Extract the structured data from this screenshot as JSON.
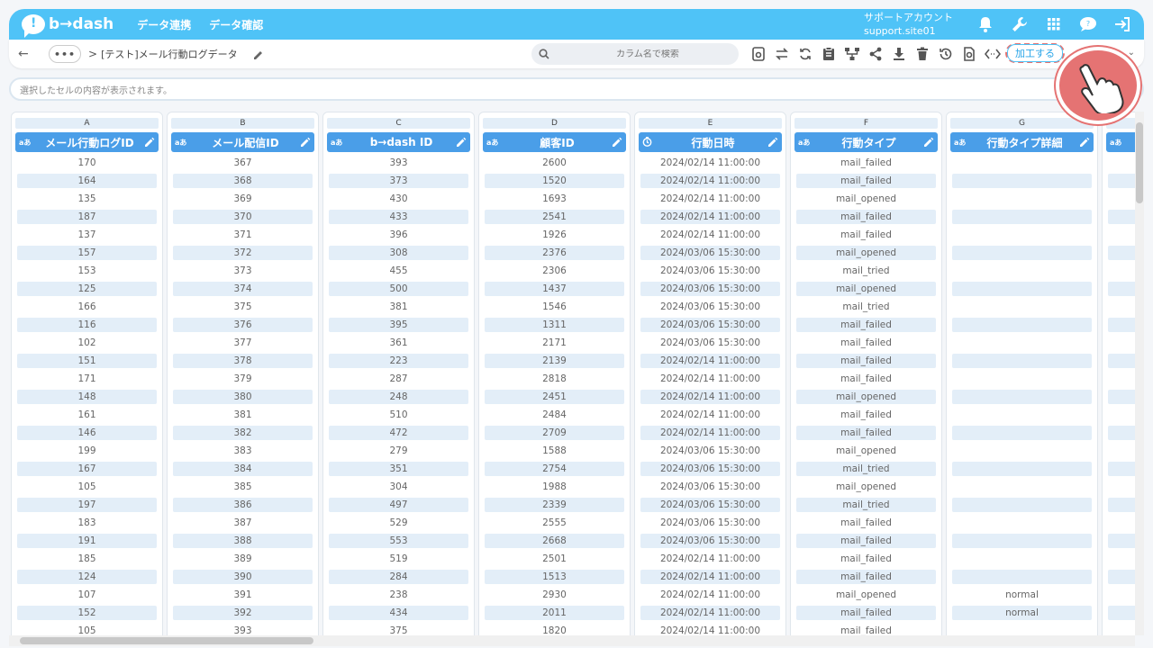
{
  "header": {
    "logo_text": "b→dash",
    "nav": [
      "データ連携",
      "データ確認"
    ],
    "account_name": "サポートアカウント",
    "account_site": "support.site01"
  },
  "toolbar": {
    "more": "•••",
    "separator": ">",
    "sheet_title": "[テスト]メール行動ログデータ",
    "search_placeholder": "カラム名で検索",
    "process_label": "加工する"
  },
  "cellbar": {
    "placeholder": "選択したセルの内容が表示されます。"
  },
  "columns": [
    {
      "letter": "A",
      "type": "aあ",
      "name": "メール行動ログID",
      "values": [
        "170",
        "164",
        "135",
        "187",
        "137",
        "157",
        "153",
        "125",
        "166",
        "116",
        "102",
        "151",
        "171",
        "148",
        "161",
        "146",
        "199",
        "167",
        "105",
        "197",
        "183",
        "191",
        "185",
        "124",
        "107",
        "152",
        "105"
      ]
    },
    {
      "letter": "B",
      "type": "aあ",
      "name": "メール配信ID",
      "values": [
        "367",
        "368",
        "369",
        "370",
        "371",
        "372",
        "373",
        "374",
        "375",
        "376",
        "377",
        "378",
        "379",
        "380",
        "381",
        "382",
        "383",
        "384",
        "385",
        "386",
        "387",
        "388",
        "389",
        "390",
        "391",
        "392",
        "393"
      ]
    },
    {
      "letter": "C",
      "type": "aあ",
      "name": "b→dash ID",
      "values": [
        "393",
        "373",
        "430",
        "433",
        "396",
        "308",
        "455",
        "500",
        "381",
        "395",
        "361",
        "223",
        "287",
        "248",
        "510",
        "472",
        "279",
        "351",
        "304",
        "497",
        "529",
        "553",
        "519",
        "284",
        "238",
        "434",
        "375"
      ]
    },
    {
      "letter": "D",
      "type": "aあ",
      "name": "顧客ID",
      "values": [
        "2600",
        "1520",
        "1693",
        "2541",
        "1926",
        "2376",
        "2306",
        "1437",
        "1546",
        "1311",
        "2171",
        "2139",
        "2818",
        "2451",
        "2484",
        "2709",
        "1588",
        "2754",
        "1988",
        "2339",
        "2555",
        "2668",
        "2501",
        "1513",
        "2930",
        "2011",
        "1820"
      ]
    },
    {
      "letter": "E",
      "type": "clock",
      "name": "行動日時",
      "values": [
        "2024/02/14 11:00:00",
        "2024/02/14 11:00:00",
        "2024/02/14 11:00:00",
        "2024/02/14 11:00:00",
        "2024/02/14 11:00:00",
        "2024/03/06 15:30:00",
        "2024/03/06 15:30:00",
        "2024/03/06 15:30:00",
        "2024/03/06 15:30:00",
        "2024/03/06 15:30:00",
        "2024/03/06 15:30:00",
        "2024/02/14 11:00:00",
        "2024/02/14 11:00:00",
        "2024/02/14 11:00:00",
        "2024/02/14 11:00:00",
        "2024/02/14 11:00:00",
        "2024/03/06 15:30:00",
        "2024/03/06 15:30:00",
        "2024/03/06 15:30:00",
        "2024/03/06 15:30:00",
        "2024/03/06 15:30:00",
        "2024/03/06 15:30:00",
        "2024/02/14 11:00:00",
        "2024/02/14 11:00:00",
        "2024/02/14 11:00:00",
        "2024/02/14 11:00:00",
        "2024/02/14 11:00:00"
      ]
    },
    {
      "letter": "F",
      "type": "aあ",
      "name": "行動タイプ",
      "values": [
        "mail_failed",
        "mail_failed",
        "mail_opened",
        "mail_failed",
        "mail_failed",
        "mail_opened",
        "mail_tried",
        "mail_opened",
        "mail_tried",
        "mail_failed",
        "mail_failed",
        "mail_failed",
        "mail_failed",
        "mail_opened",
        "mail_failed",
        "mail_failed",
        "mail_opened",
        "mail_tried",
        "mail_opened",
        "mail_tried",
        "mail_failed",
        "mail_failed",
        "mail_failed",
        "mail_failed",
        "mail_opened",
        "mail_failed",
        "mail_failed"
      ]
    },
    {
      "letter": "G",
      "type": "aあ",
      "name": "行動タイプ詳細",
      "values": [
        "",
        "",
        "",
        "",
        "",
        "",
        "",
        "",
        "",
        "",
        "",
        "",
        "",
        "",
        "",
        "",
        "",
        "",
        "",
        "",
        "",
        "",
        "",
        "",
        "normal",
        "normal",
        ""
      ]
    },
    {
      "letter": "",
      "type": "aあ",
      "name": "",
      "values": [
        "",
        "",
        "",
        "",
        "",
        "",
        "",
        "",
        "",
        "",
        "",
        "",
        "",
        "",
        "",
        "",
        "",
        "",
        "",
        "",
        "",
        "",
        "",
        "",
        "",
        "",
        ""
      ]
    }
  ],
  "colors": {
    "accent": "#4fc3f7",
    "header_cell": "#4a9ee8",
    "alt_row": "#e3eef8",
    "highlight": "#e57373"
  }
}
